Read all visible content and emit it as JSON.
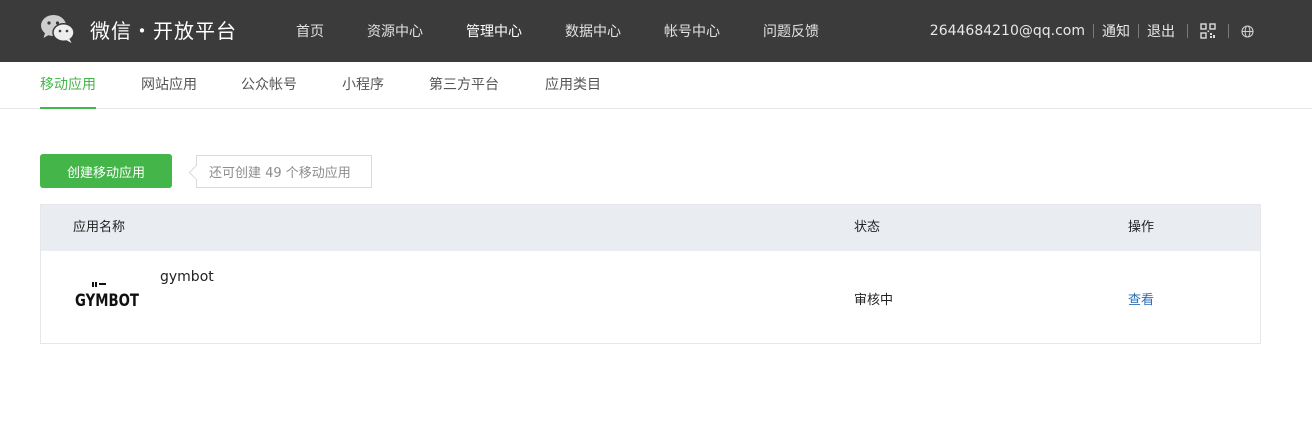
{
  "header": {
    "logo_text": "微信・开放平台",
    "nav": [
      {
        "label": "首页",
        "active": false
      },
      {
        "label": "资源中心",
        "active": false
      },
      {
        "label": "管理中心",
        "active": true
      },
      {
        "label": "数据中心",
        "active": false
      },
      {
        "label": "帐号中心",
        "active": false
      },
      {
        "label": "问题反馈",
        "active": false
      }
    ],
    "user_email": "2644684210@qq.com",
    "notify_label": "通知",
    "logout_label": "退出",
    "icons": [
      "qrcode-icon",
      "globe-icon"
    ]
  },
  "subnav": {
    "items": [
      {
        "label": "移动应用",
        "active": true
      },
      {
        "label": "网站应用",
        "active": false
      },
      {
        "label": "公众帐号",
        "active": false
      },
      {
        "label": "小程序",
        "active": false
      },
      {
        "label": "第三方平台",
        "active": false
      },
      {
        "label": "应用类目",
        "active": false
      }
    ]
  },
  "actions": {
    "create_label": "创建移动应用",
    "quota_text": "还可创建 49 个移动应用"
  },
  "table": {
    "headers": {
      "name": "应用名称",
      "status": "状态",
      "action": "操作"
    },
    "rows": [
      {
        "logo_text": "GYMBOT",
        "name": "gymbot",
        "status": "审核中",
        "action": "查看"
      }
    ]
  },
  "colors": {
    "topbar": "#3b3b3b",
    "accent": "#44b549",
    "link": "#2b6fb3",
    "table_header": "#e9edf2"
  }
}
